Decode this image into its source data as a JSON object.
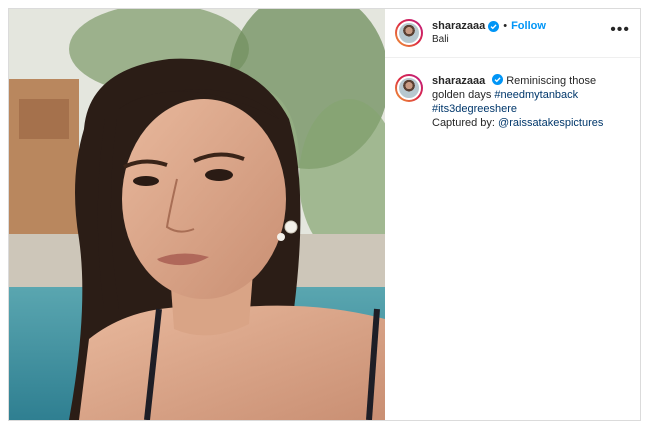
{
  "post": {
    "username": "sharazaaa",
    "follow_label": "Follow",
    "separator": "•",
    "location": "Bali",
    "more_label": "•••",
    "caption": {
      "username": "sharazaaa",
      "text": "Reminiscing those golden days",
      "hashtag1": "#needmytanback",
      "hashtag2": "#its3degreeshere",
      "credit_prefix": "Captured by:",
      "credit_mention": "@raissatakespictures"
    }
  },
  "icons": {
    "verified": "verified-badge-icon",
    "more": "more-options-icon"
  },
  "colors": {
    "accent": "#0095f6",
    "link": "#00376b",
    "text": "#262626",
    "border": "#dbdbdb"
  }
}
